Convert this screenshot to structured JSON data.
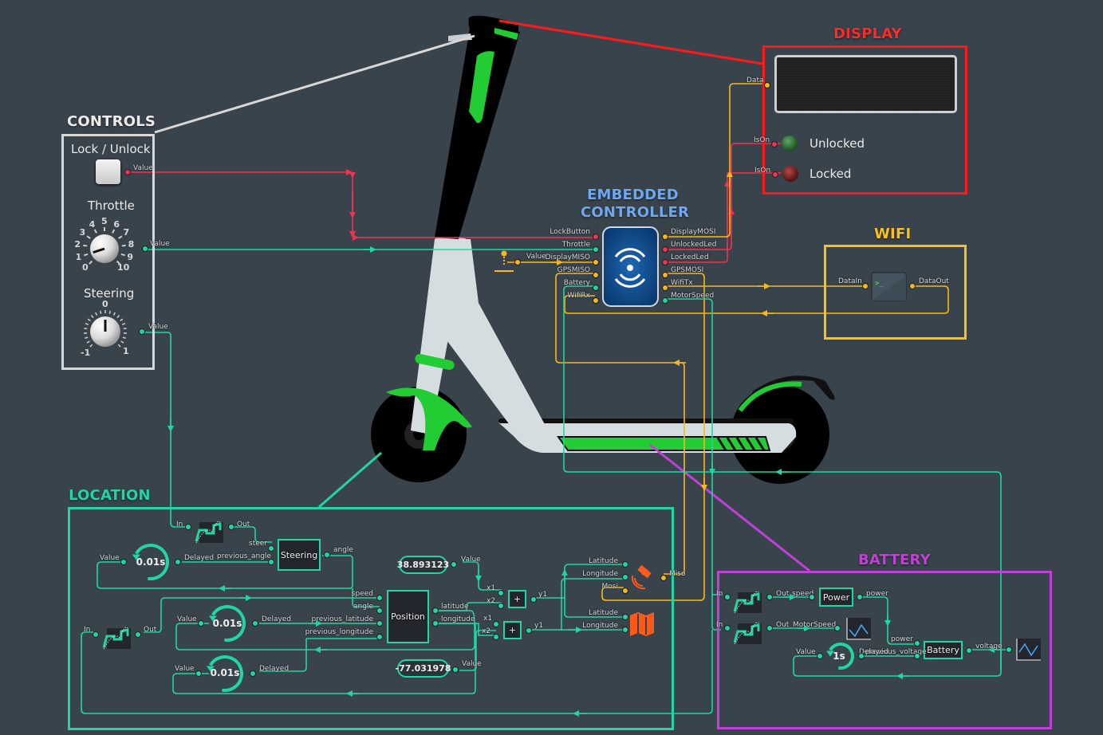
{
  "colors": {
    "background": "#39434b",
    "signal_teal": "#1fd6a4",
    "signal_yellow": "#f6b81a",
    "signal_red": "#ec3552",
    "display_frame": "#ff1a1a",
    "wifi_frame": "#f7c21b",
    "battery_frame": "#c140d8",
    "location_frame": "#1fd6a4",
    "controller_title": "#6ea8f0",
    "scooter_green": "#22cc33"
  },
  "groups": {
    "controls": "CONTROLS",
    "display": "DISPLAY",
    "embedded": [
      "EMBEDDED",
      "CONTROLLER"
    ],
    "wifi": "WIFI",
    "location": "LOCATION",
    "battery": "BATTERY"
  },
  "controls": {
    "lock_label": "Lock / Unlock",
    "lock_port": "Value",
    "throttle_label": "Throttle",
    "throttle_port": "Value",
    "throttle_ticks": [
      "0",
      "1",
      "2",
      "3",
      "4",
      "5",
      "6",
      "7",
      "8",
      "9",
      "10"
    ],
    "throttle_value": 1,
    "steering_label": "Steering",
    "steering_port": "Value",
    "steering_ticks": [
      "-1",
      "0",
      "1"
    ],
    "steering_value": 0
  },
  "controller": {
    "icon": "target-radar-icon",
    "inputs": [
      "LockButton",
      "Throttle",
      "DisplayMISO",
      "GPSMISO",
      "Battery",
      "WifiRx"
    ],
    "outputs": [
      "DisplayMOSI",
      "UnlockedLed",
      "LockedLed",
      "GPSMOSI",
      "WifiTx",
      "MotorSpeed"
    ],
    "ground_port": "Value"
  },
  "display": {
    "data_port": "Data",
    "screen_text": "",
    "leds": [
      {
        "label": "Unlocked",
        "port": "IsOn",
        "color": "#2e7d32"
      },
      {
        "label": "Locked",
        "port": "IsOn",
        "color": "#8b1a1a"
      }
    ]
  },
  "wifi": {
    "in_port": "DataIn",
    "out_port": "DataOut",
    "icon": "terminal-icon"
  },
  "location": {
    "steer_filter": {
      "in": "In",
      "out": "Out"
    },
    "steering_block": {
      "label": "Steering",
      "in": [
        "steer",
        "previous_angle"
      ],
      "out": "angle"
    },
    "delay_angle": {
      "value": "Value",
      "time": "0.01s",
      "out": "Delayed"
    },
    "speed_filter": {
      "in": "In",
      "out": "Out"
    },
    "delay_lat": {
      "value": "Value",
      "time": "0.01s",
      "out": "Delayed"
    },
    "delay_lon": {
      "value": "Value",
      "time": "0.01s",
      "out": "Delayed"
    },
    "position_block": {
      "label": "Position",
      "in": [
        "speed",
        "angle",
        "previous_latitude",
        "previous_longitude"
      ],
      "out": [
        "latitude",
        "longitude"
      ]
    },
    "const_lat": {
      "value": "38.893123",
      "port": "Value"
    },
    "const_lon": {
      "value": "-77.031978",
      "port": "Value"
    },
    "add1": {
      "label": "+",
      "in": [
        "x1",
        "x2"
      ],
      "out": "y1"
    },
    "add2": {
      "label": "+",
      "in": [
        "x1",
        "x2"
      ],
      "out": "y1"
    },
    "gps": {
      "in": [
        "Latitude",
        "Longitude",
        "Mosi"
      ],
      "out": "Miso"
    },
    "map": {
      "in": [
        "Latitude",
        "Longitude"
      ]
    }
  },
  "battery": {
    "filter1": {
      "in": "In",
      "out": "Out"
    },
    "filter2": {
      "in": "In",
      "out": "Out"
    },
    "power_block": {
      "label": "Power",
      "in": "speed",
      "out": "power"
    },
    "motor_chart_port": "MotorSpeed",
    "battery_block": {
      "label": "Battery",
      "in": [
        "power",
        "previous_voltage"
      ],
      "out": "voltage"
    },
    "delay": {
      "value": "Value",
      "time": "1s",
      "out": "Delayed"
    },
    "voltage_chart_port": "voltage"
  }
}
